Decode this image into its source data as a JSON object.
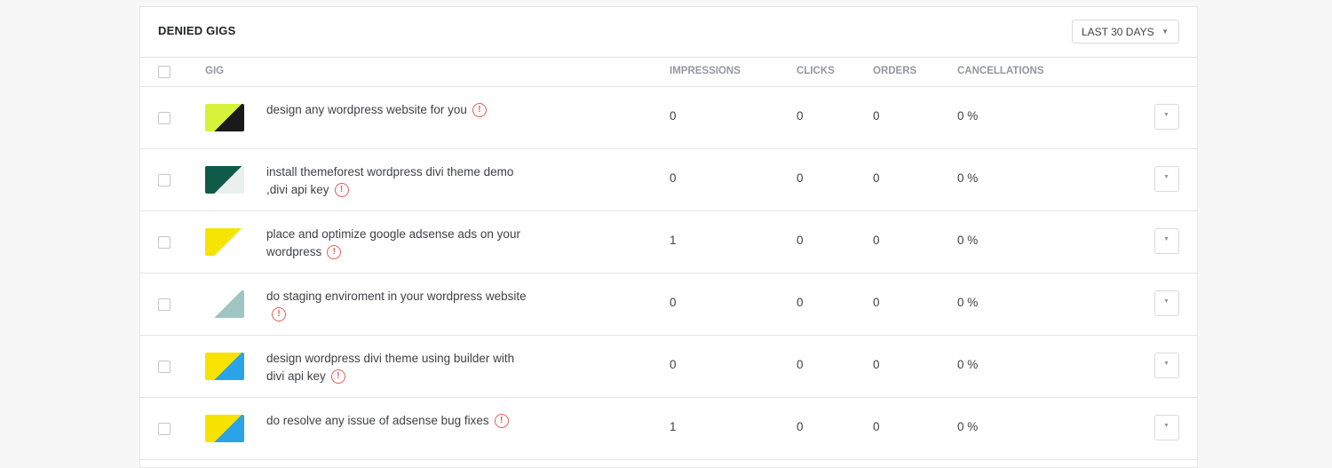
{
  "panel": {
    "title": "DENIED GIGS",
    "range_label": "LAST 30 DAYS"
  },
  "columns": {
    "gig": "GIG",
    "impressions": "IMPRESSIONS",
    "clicks": "CLICKS",
    "orders": "ORDERS",
    "cancellations": "CANCELLATIONS"
  },
  "warning_icon": "!",
  "rows": [
    {
      "title": "design any wordpress website for you",
      "impressions": "0",
      "clicks": "0",
      "orders": "0",
      "cancellations": "0 %",
      "thumb_colors": [
        "#d6f23a",
        "#1a1a1a"
      ]
    },
    {
      "title": "install themeforest wordpress divi theme demo ,divi api key",
      "impressions": "0",
      "clicks": "0",
      "orders": "0",
      "cancellations": "0 %",
      "thumb_colors": [
        "#0f5a48",
        "#e9f0ee"
      ]
    },
    {
      "title": "place and optimize google adsense ads on your wordpress",
      "impressions": "1",
      "clicks": "0",
      "orders": "0",
      "cancellations": "0 %",
      "thumb_colors": [
        "#f6e300",
        "#ffffff"
      ]
    },
    {
      "title": "do staging enviroment in your wordpress website",
      "impressions": "0",
      "clicks": "0",
      "orders": "0",
      "cancellations": "0 %",
      "thumb_colors": [
        "#ffffff",
        "#9fc6c2"
      ]
    },
    {
      "title": "design wordpress divi theme using builder with divi api key",
      "impressions": "0",
      "clicks": "0",
      "orders": "0",
      "cancellations": "0 %",
      "thumb_colors": [
        "#f6e300",
        "#2aa3e8"
      ]
    },
    {
      "title": "do resolve any issue of adsense bug fixes",
      "impressions": "1",
      "clicks": "0",
      "orders": "0",
      "cancellations": "0 %",
      "thumb_colors": [
        "#f6e300",
        "#2aa3e8"
      ]
    }
  ]
}
